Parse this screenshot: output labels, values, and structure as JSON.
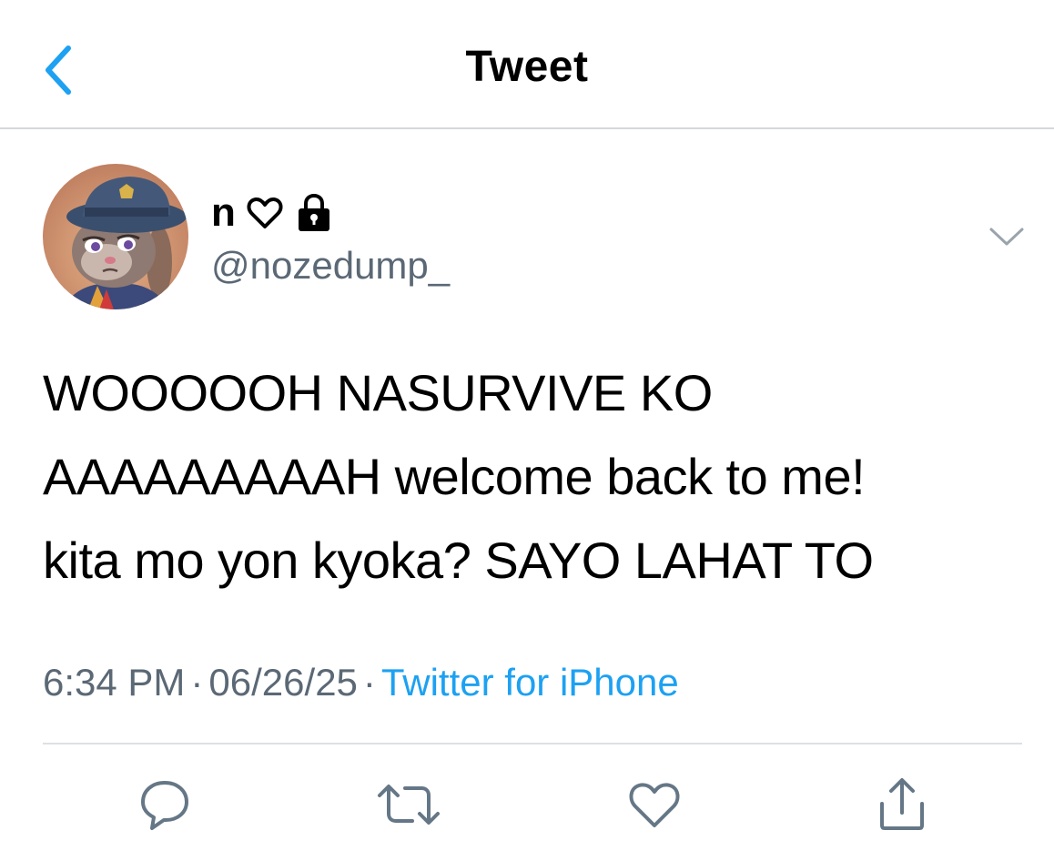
{
  "header": {
    "title": "Tweet",
    "back_icon": "chevron-left-icon"
  },
  "author": {
    "display_name": "n",
    "heart_icon": "heart-outline-icon",
    "lock_icon": "lock-icon",
    "handle": "@nozedump_",
    "more_icon": "chevron-down-icon"
  },
  "tweet": {
    "lines": [
      "WOOOOOH NASURVIVE KO",
      "AAAAAAAAAH welcome back to me!",
      "kita mo yon kyoka? SAYO LAHAT TO"
    ]
  },
  "meta": {
    "time": "6:34 PM",
    "separator": "·",
    "date": "06/26/25",
    "source": "Twitter for iPhone"
  },
  "actions": [
    {
      "name": "reply-icon"
    },
    {
      "name": "retweet-icon"
    },
    {
      "name": "like-icon"
    },
    {
      "name": "share-icon"
    }
  ],
  "colors": {
    "accent": "#1DA1F2",
    "secondary_text": "#5B6875",
    "divider": "#DDE1E4",
    "icon_gray": "#657786"
  }
}
